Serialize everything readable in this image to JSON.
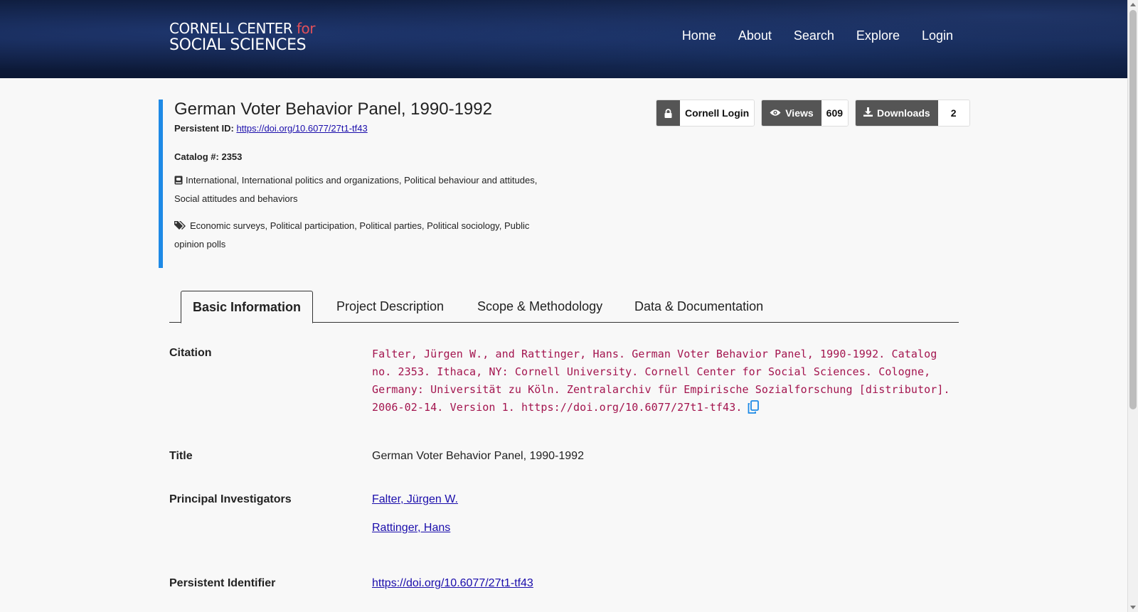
{
  "header": {
    "logo_line1": "CORNELL CENTER",
    "logo_for": "for",
    "logo_line2": "SOCIAL SCIENCES",
    "nav": [
      "Home",
      "About",
      "Search",
      "Explore",
      "Login"
    ]
  },
  "study": {
    "title": "German Voter Behavior Panel, 1990-1992",
    "persistent_id_label": "Persistent ID:",
    "persistent_id": "https://doi.org/10.6077/27t1-tf43",
    "catalog_label": "Catalog #:",
    "catalog_number": "2353",
    "topics": "International, International politics and organizations, Political behaviour and attitudes, Social attitudes and behaviors",
    "keywords": "Economic surveys, Political participation, Political parties, Political sociology, Public opinion polls"
  },
  "stats": {
    "login_label": "Cornell Login",
    "views_label": "Views",
    "views_count": "609",
    "downloads_label": "Downloads",
    "downloads_count": "2"
  },
  "tabs": [
    "Basic Information",
    "Project Description",
    "Scope & Methodology",
    "Data & Documentation"
  ],
  "fields": {
    "citation_label": "Citation",
    "citation_text": "Falter, Jürgen W., and Rattinger, Hans. German Voter Behavior Panel, 1990-1992. Catalog no. 2353. Ithaca, NY: Cornell University. Cornell Center for Social Sciences. Cologne, Germany: Universität zu Köln. Zentralarchiv für Empirische Sozialforschung [distributor]. 2006-02-14. Version 1. https://doi.org/10.6077/27t1-tf43.",
    "title_label": "Title",
    "title_value": "German Voter Behavior Panel, 1990-1992",
    "pi_label": "Principal Investigators",
    "pi_1": "Falter, Jürgen W.",
    "pi_2": "Rattinger, Hans",
    "pid_label": "Persistent Identifier",
    "pid_value": "https://doi.org/10.6077/27t1-tf43"
  },
  "colors": {
    "accent_bar": "#1e8ae6",
    "citation_text": "#a3144e",
    "button_dark": "#555555",
    "logo_for": "#e0505a"
  }
}
